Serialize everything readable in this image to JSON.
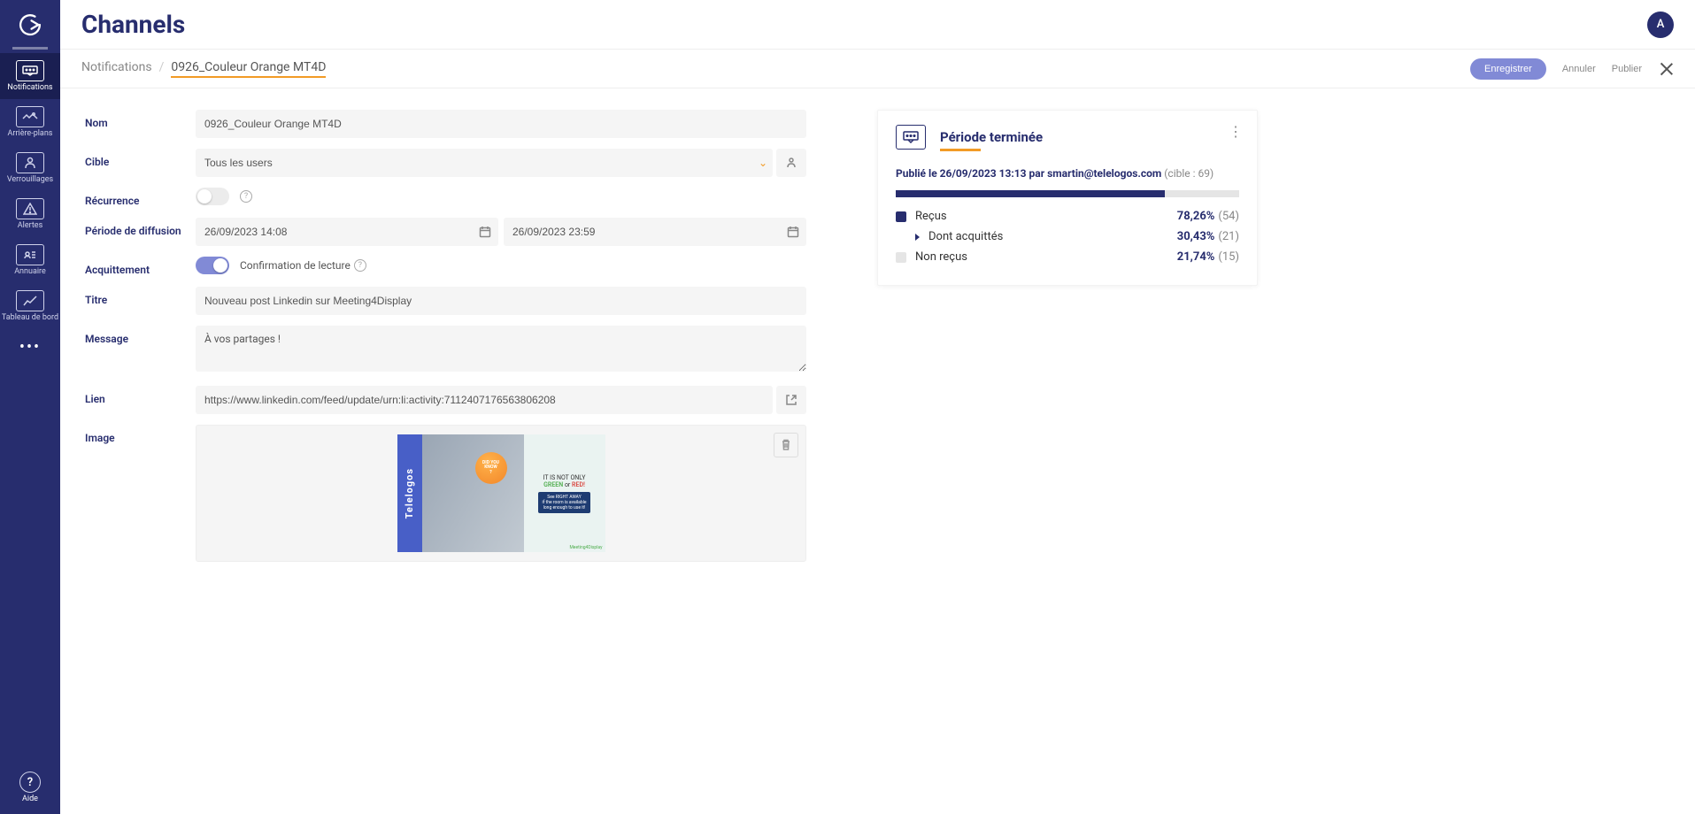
{
  "header": {
    "page_title": "Channels",
    "avatar_letter": "A"
  },
  "breadcrumb": {
    "parent": "Notifications",
    "current": "0926_Couleur Orange MT4D"
  },
  "actions": {
    "save": "Enregistrer",
    "cancel": "Annuler",
    "publish": "Publier"
  },
  "sidebar": {
    "items": [
      {
        "label": "Notifications",
        "icon": "⋯"
      },
      {
        "label": "Arrière-plans",
        "icon": "🖼"
      },
      {
        "label": "Verrouillages",
        "icon": "👤"
      },
      {
        "label": "Alertes",
        "icon": "⚠"
      },
      {
        "label": "Annuaire",
        "icon": "📇"
      },
      {
        "label": "Tableau de bord",
        "icon": "📈"
      }
    ],
    "help": "Aide"
  },
  "form": {
    "labels": {
      "nom": "Nom",
      "cible": "Cible",
      "recurrence": "Récurrence",
      "periode": "Période de diffusion",
      "acquittement": "Acquittement",
      "titre": "Titre",
      "message": "Message",
      "lien": "Lien",
      "image": "Image"
    },
    "nom_value": "0926_Couleur Orange MT4D",
    "cible_value": "Tous les users",
    "periode_start": "26/09/2023 14:08",
    "periode_end": "26/09/2023 23:59",
    "confirm_label": "Confirmation de lecture",
    "titre_value": "Nouveau post Linkedin sur Meeting4Display",
    "message_value": "À vos partages !",
    "lien_value": "https://www.linkedin.com/feed/update/urn:li:activity:7112407176563806208"
  },
  "image_preview": {
    "brand": "Telelogos",
    "bubble_l1": "DID YOU",
    "bubble_l2": "KNOW",
    "right_l1": "IT IS NOT ONLY",
    "right_green": "GREEN",
    "right_or": " or ",
    "right_red": "RED!",
    "sub_l1": "See RIGHT AWAY",
    "sub_l2": "if the room is available",
    "sub_l3": "long enough to use it!",
    "logo_text": "Meeting4Display"
  },
  "stats": {
    "title": "Période terminée",
    "published_prefix": "Publié le ",
    "published_date": "26/09/2023 13:13",
    "published_by_label": " par ",
    "published_by": "smartin@telelogos.com",
    "cible_label": " (cible : ",
    "cible_value": "69",
    "cible_close": ")",
    "progress_pct": 78.26,
    "rows": [
      {
        "label": "Reçus",
        "pct": "78,26%",
        "count": "(54)",
        "kind": "received"
      },
      {
        "label": "Dont acquittés",
        "pct": "30,43%",
        "count": "(21)",
        "kind": "ack"
      },
      {
        "label": "Non reçus",
        "pct": "21,74%",
        "count": "(15)",
        "kind": "notreceived"
      }
    ]
  }
}
